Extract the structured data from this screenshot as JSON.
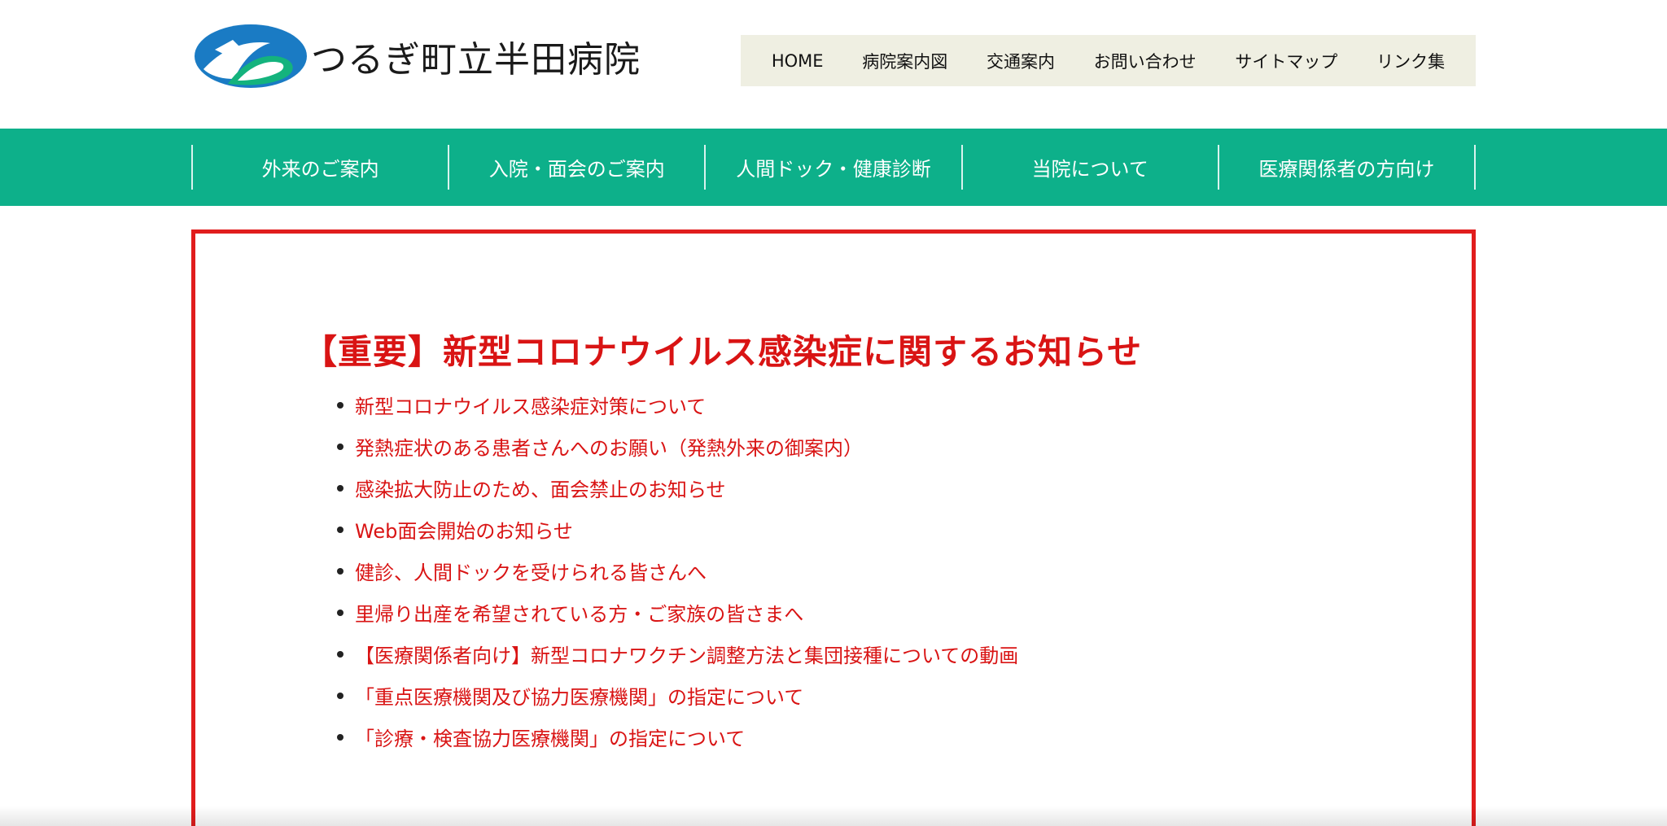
{
  "site": {
    "title": "つるぎ町立半田病院",
    "colors": {
      "logo_blue": "#1a7bc4",
      "logo_green": "#14b37d",
      "nav_green": "#0db08a",
      "notice_red": "#e11d1d"
    }
  },
  "util_nav": [
    {
      "label": "HOME"
    },
    {
      "label": "病院案内図"
    },
    {
      "label": "交通案内"
    },
    {
      "label": "お問い合わせ"
    },
    {
      "label": "サイトマップ"
    },
    {
      "label": "リンク集"
    }
  ],
  "main_nav": [
    {
      "label": "外来のご案内"
    },
    {
      "label": "入院・面会のご案内"
    },
    {
      "label": "人間ドック・健康診断"
    },
    {
      "label": "当院について"
    },
    {
      "label": "医療関係者の方向け"
    }
  ],
  "notice": {
    "title": "【重要】新型コロナウイルス感染症に関するお知らせ",
    "items": [
      {
        "label": "新型コロナウイルス感染症対策について"
      },
      {
        "label": "発熱症状のある患者さんへのお願い（発熱外来の御案内）"
      },
      {
        "label": "感染拡大防止のため、面会禁止のお知らせ"
      },
      {
        "label": "Web面会開始のお知らせ"
      },
      {
        "label": "健診、人間ドックを受けられる皆さんへ"
      },
      {
        "label": "里帰り出産を希望されている方・ご家族の皆さまへ"
      },
      {
        "label": "【医療関係者向け】新型コロナワクチン調整方法と集団接種についての動画"
      },
      {
        "label": "「重点医療機関及び協力医療機関」の指定について"
      },
      {
        "label": "「診療・検査協力医療機関」の指定について"
      }
    ]
  }
}
